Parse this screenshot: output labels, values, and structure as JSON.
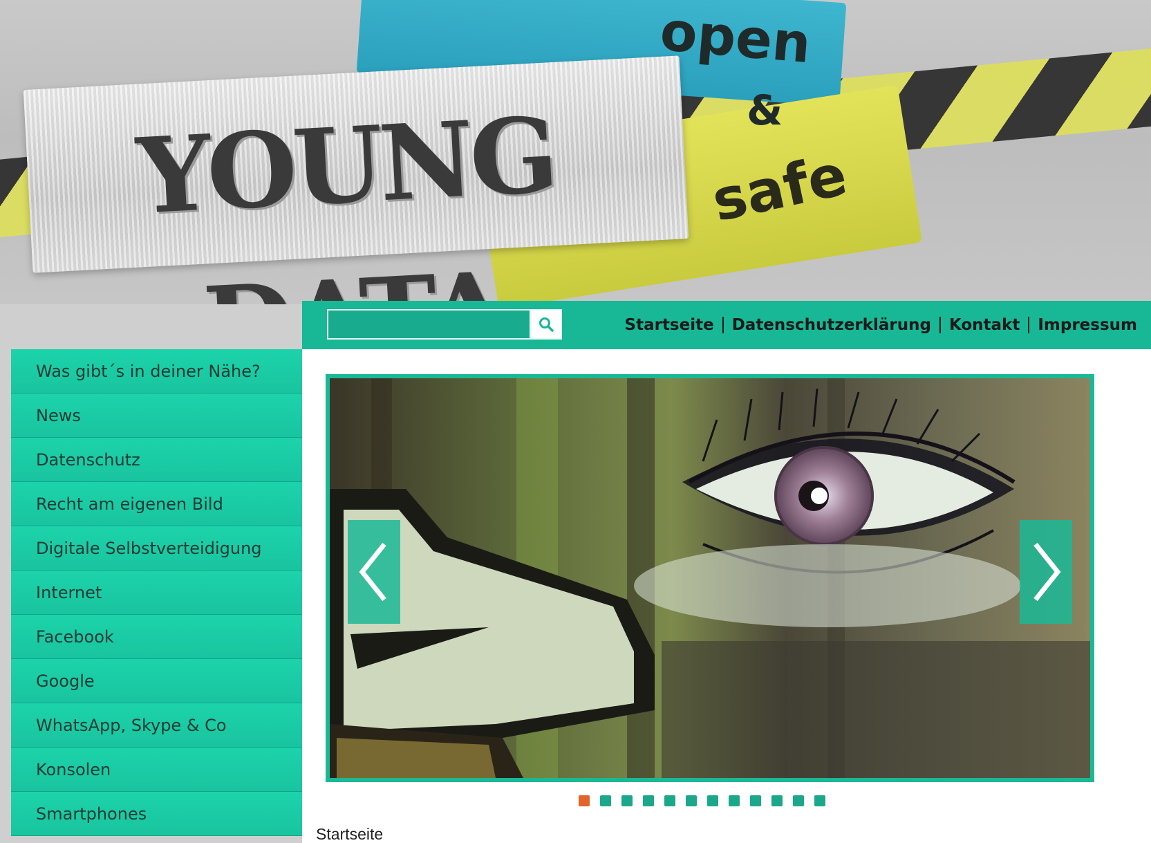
{
  "header": {
    "logo_main": "YOUNG DATA",
    "logo_open": "open",
    "logo_amp": "&",
    "logo_safe": "safe"
  },
  "search": {
    "placeholder": ""
  },
  "topnav": {
    "items": [
      {
        "label": "Startseite"
      },
      {
        "label": "Datenschutzerklärung"
      },
      {
        "label": "Kontakt"
      },
      {
        "label": "Impressum"
      }
    ]
  },
  "sidebar": {
    "items": [
      {
        "label": "Was gibt´s in deiner Nähe?"
      },
      {
        "label": "News"
      },
      {
        "label": "Datenschutz"
      },
      {
        "label": "Recht am eigenen Bild"
      },
      {
        "label": "Digitale Selbstverteidigung"
      },
      {
        "label": "Internet"
      },
      {
        "label": "Facebook"
      },
      {
        "label": "Google"
      },
      {
        "label": "WhatsApp, Skype & Co"
      },
      {
        "label": "Konsolen"
      },
      {
        "label": "Smartphones"
      }
    ]
  },
  "slider": {
    "slide_count": 12,
    "active_index": 0,
    "prev_icon": "chevron-left-icon",
    "next_icon": "chevron-right-icon"
  },
  "main": {
    "breadcrumb": "Startseite"
  },
  "colors": {
    "accent": "#18b896",
    "sidebar": "#1cd3aa",
    "active_dot": "#e2642c",
    "dot": "#1ba88a"
  }
}
